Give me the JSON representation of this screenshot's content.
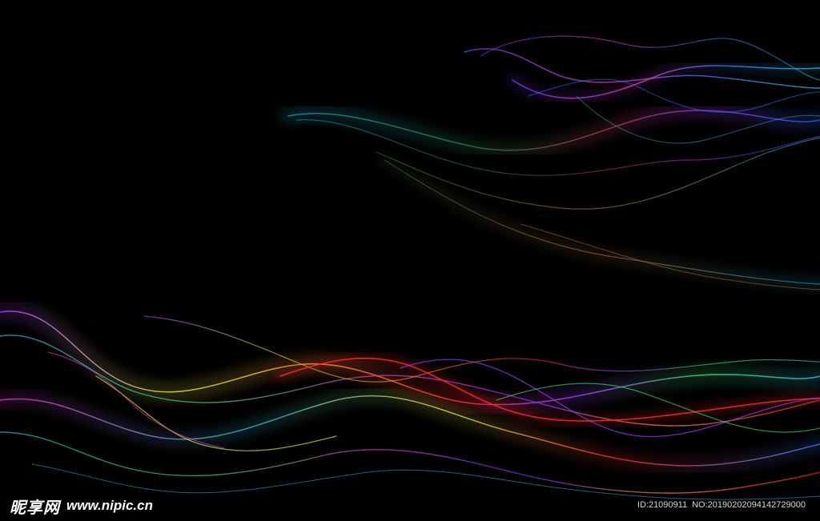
{
  "background_color": "#000000",
  "watermark": {
    "brand": "昵享网",
    "url": "www.nipic.cn",
    "id_label": "ID:21090911",
    "no_label": "NO:20190202094142729000"
  },
  "palette": {
    "cyan": "#2fb8d8",
    "blue": "#2a6cff",
    "purple": "#a23cff",
    "magenta": "#e03ac8",
    "red": "#ff2a2a",
    "orange": "#ff8a2a",
    "yellow": "#d6e23a",
    "green": "#3ad66a"
  }
}
